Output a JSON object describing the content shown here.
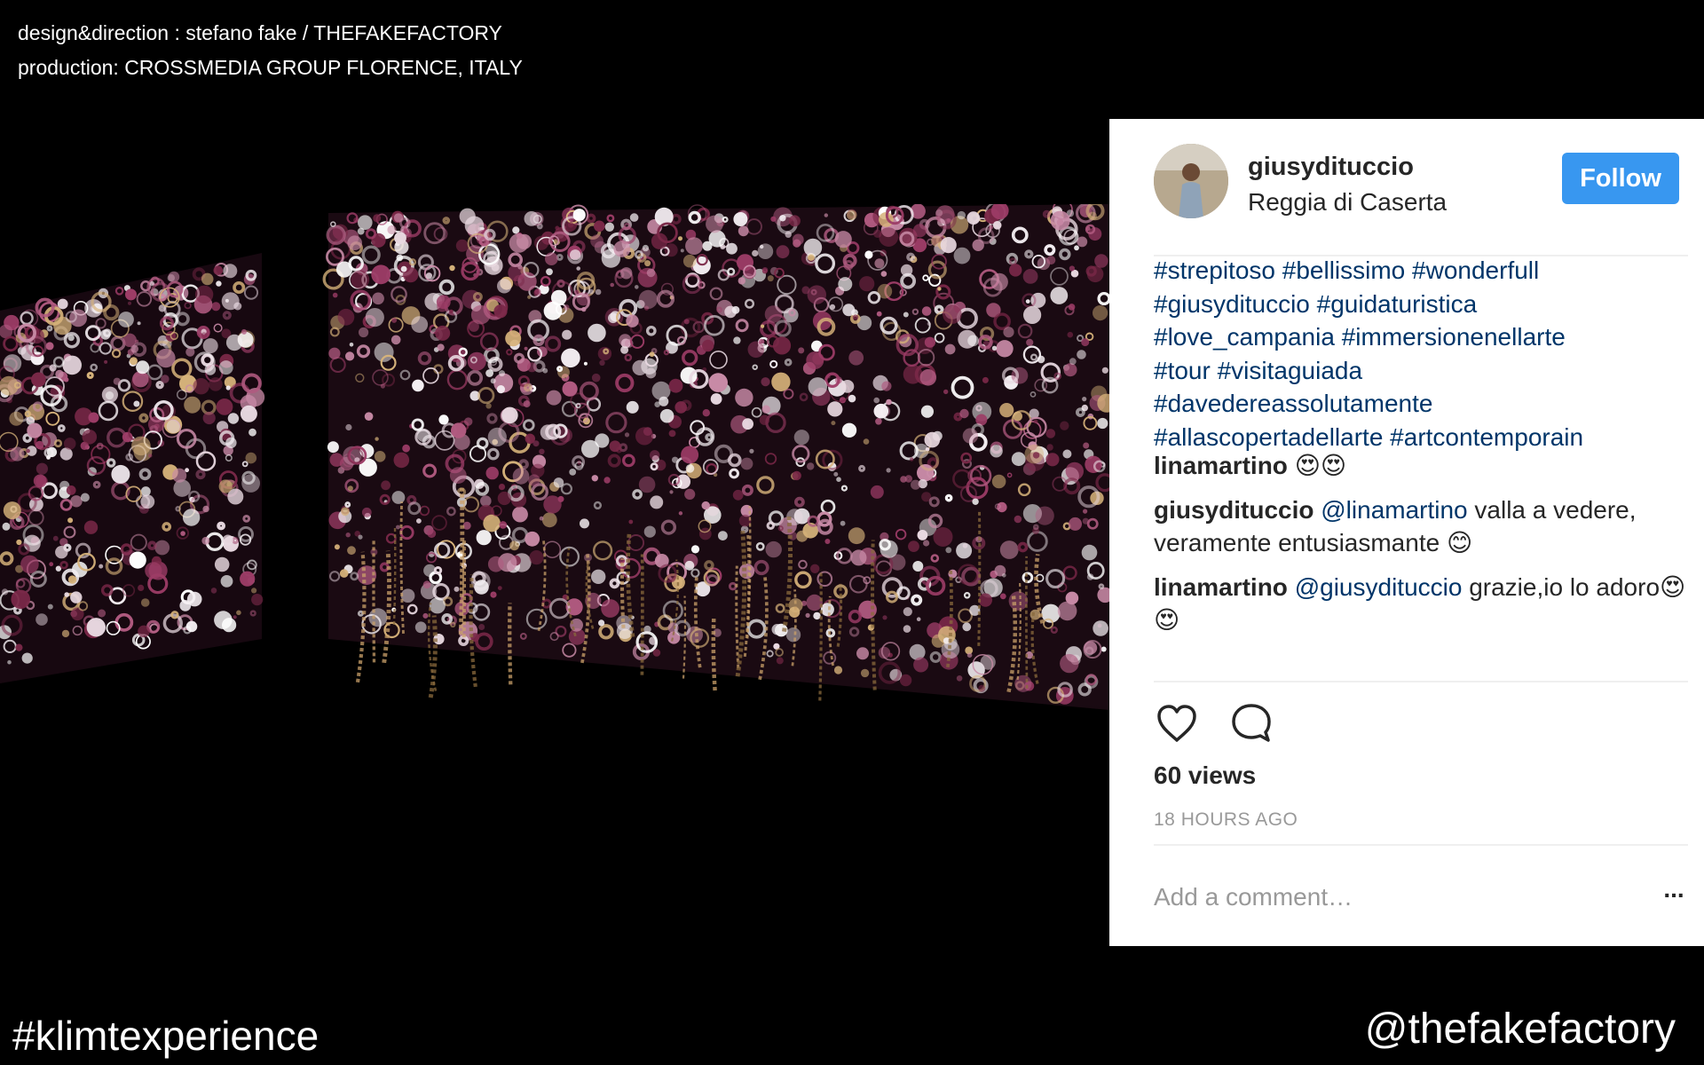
{
  "credits": {
    "line1": "design&direction : stefano fake / THEFAKEFACTORY",
    "line2": "production: CROSSMEDIA GROUP FLORENCE, ITALY"
  },
  "post": {
    "username": "giusydituccio",
    "location": "Reggia di Caserta",
    "follow_label": "Follow",
    "caption_lines": [
      [
        "#strepitoso",
        "#bellissimo",
        "#wonderfull"
      ],
      [
        "#giusydituccio",
        "#guidaturistica"
      ],
      [
        "#love_campania",
        "#immersionenellarte"
      ],
      [
        "#tour",
        "#visitaguiada"
      ],
      [
        "#davedereassolutamente"
      ],
      [
        "#allascopertadellarte",
        "#artcontemporain"
      ]
    ],
    "comments": [
      {
        "user": "linamartino",
        "mention": "",
        "text": "",
        "emoji": "😍😍"
      },
      {
        "user": "giusydituccio",
        "mention": "@linamartino",
        "text": " valla a vedere, veramente entusiasmante ",
        "emoji": "😊"
      },
      {
        "user": "linamartino",
        "mention": "@giusydituccio",
        "text": " grazie,io lo adoro",
        "emoji": "😍😍"
      }
    ],
    "views": "60 views",
    "timestamp": "18 HOURS AGO",
    "comment_placeholder": "Add a comment…",
    "more_label": "...",
    "icons": [
      "heart-icon",
      "comment-icon",
      "more-options-icon"
    ],
    "colors": {
      "follow": "#3897f0",
      "hashtag": "#003569",
      "muted": "#999999"
    }
  },
  "footer": {
    "hashtag": "#klimtexperience",
    "handle": "@thefakefactory"
  }
}
